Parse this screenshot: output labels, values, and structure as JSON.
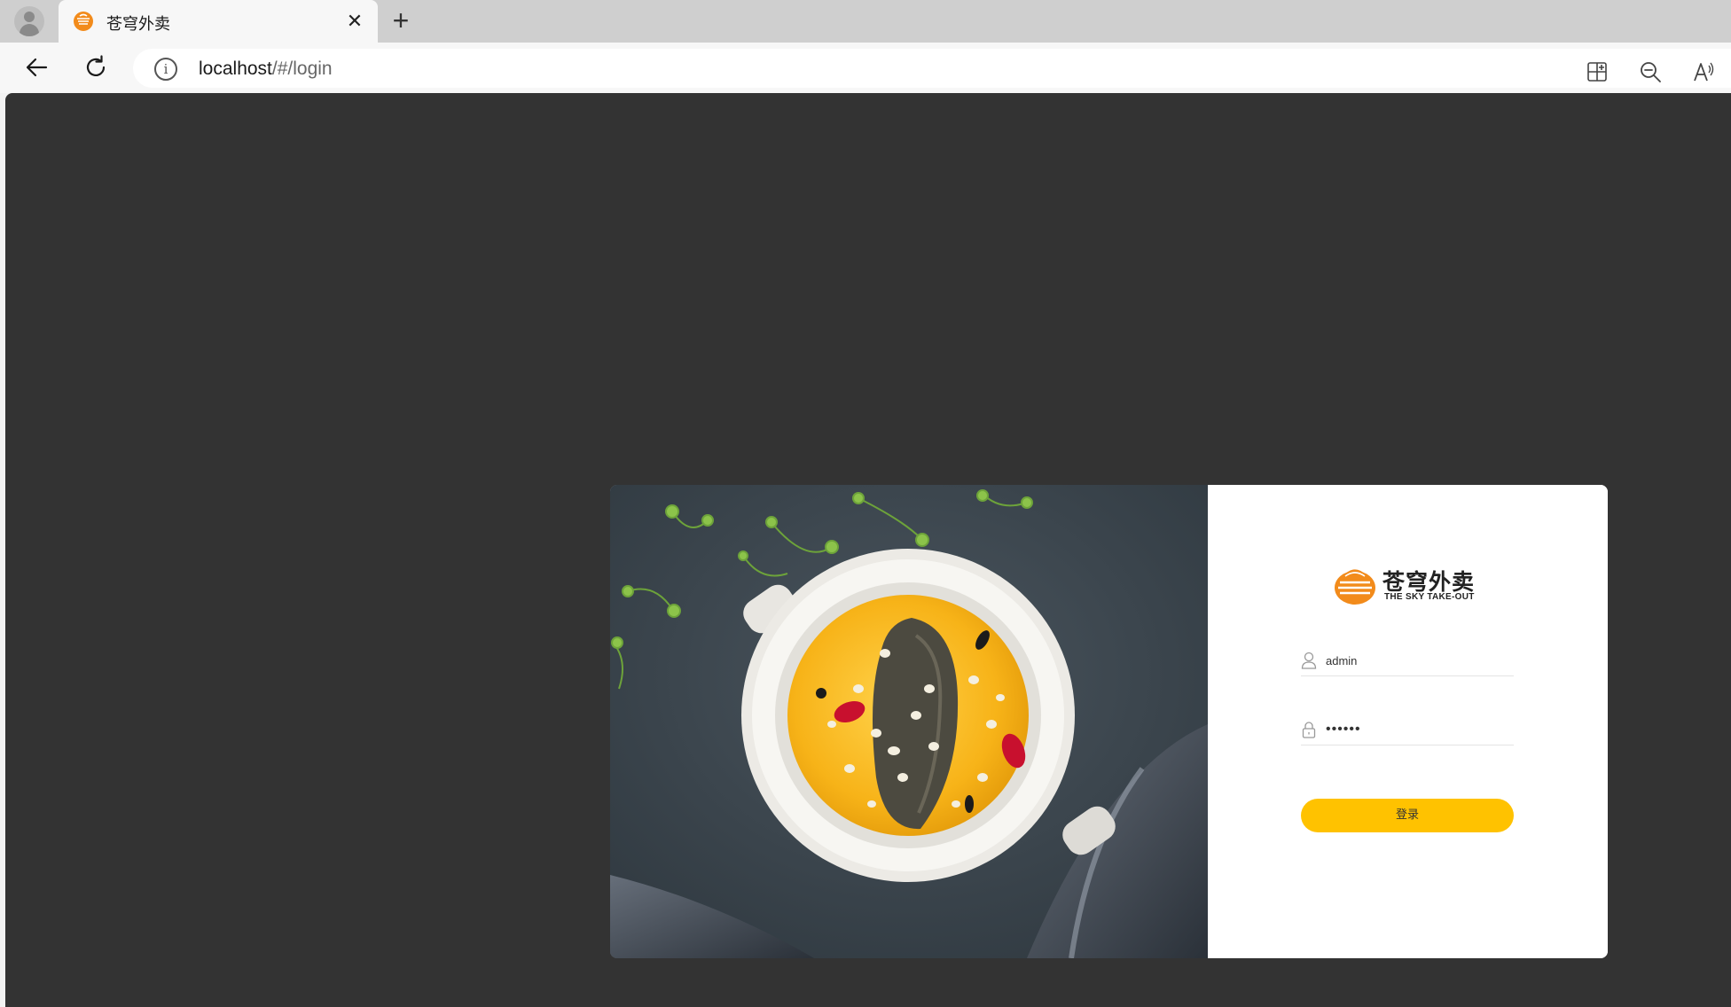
{
  "browser": {
    "tab": {
      "title": "苍穹外卖",
      "favicon": "sky-takeout-logo"
    },
    "address": {
      "host": "localhost",
      "path": "/#/login"
    },
    "icons": {
      "profile": "profile-icon",
      "close": "close-icon",
      "new_tab": "plus-icon",
      "back": "back-arrow-icon",
      "reload": "reload-icon",
      "site_info": "info-icon",
      "apps": "apps-icon",
      "zoom": "zoom-out-icon",
      "read_aloud": "read-aloud-icon"
    }
  },
  "page": {
    "background_color": "#333333",
    "food_image": "sea-cucumber-millet-soup-bowl",
    "logo": {
      "cn": "苍穹外卖",
      "en": "THE SKY TAKE-OUT"
    },
    "login": {
      "username_value": "admin",
      "password_value": "••••••",
      "submit_label": "登录",
      "accent_color": "#ffc200"
    }
  }
}
